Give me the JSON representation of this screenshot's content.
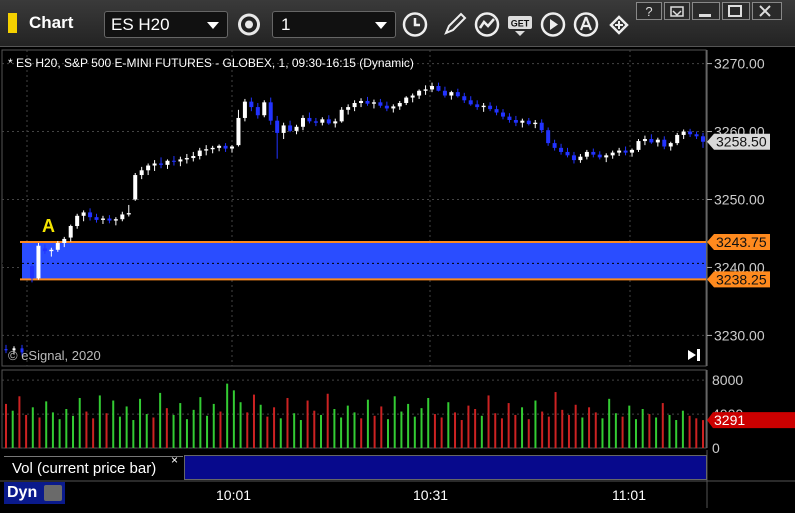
{
  "app": {
    "title": "Chart"
  },
  "toolbar": {
    "symbol": "ES H20",
    "interval": "1",
    "buttons": [
      "gear-icon",
      "clock-icon",
      "pencil-icon",
      "study-icon",
      "get-icon",
      "play-icon",
      "cursor-icon",
      "link-icon"
    ],
    "get_label": "GET"
  },
  "window": {
    "buttons": [
      "help",
      "restore",
      "maximize",
      "close"
    ],
    "help_label": "?"
  },
  "chart": {
    "header": "* ES H20, S&P 500 E-MINI FUTURES - GLOBEX, 1, 09:30-16:15 (Dynamic)",
    "copyright": "© eSignal, 2020",
    "marker_label": "A",
    "price_axis": [
      "3270.00",
      "3260.00",
      "3250.00",
      "3240.00",
      "3230.00"
    ],
    "last_price": "3258.50",
    "band_upper": "3243.75",
    "band_lower": "3238.25",
    "volume_axis": [
      "8000",
      "4000",
      "0"
    ],
    "volume_last": "3291",
    "time_axis": [
      "10:01",
      "10:31",
      "11:01"
    ],
    "colors": {
      "up": "#ffffff",
      "down": "#2233ff",
      "band": "#2a4dff",
      "band_line": "#ff8a1e",
      "vol_up": "#33cc33",
      "vol_down": "#cc2222",
      "last_price_bg": "#d8d8d8",
      "vol_last_bg": "#cc0000"
    }
  },
  "lower_panel": {
    "label": "Vol (current price bar)",
    "close": "×"
  },
  "footer": {
    "dyn": "Dyn"
  },
  "chart_data": {
    "type": "candlestick",
    "x_range": [
      "09:38",
      "11:13"
    ],
    "ylim": [
      3225.5,
      3272.0
    ],
    "candles": [
      [
        3240.2,
        3240.5,
        3237.8,
        3238.4
      ],
      [
        3238.4,
        3243.6,
        3238.2,
        3243.2
      ],
      [
        3242.8,
        3243.4,
        3242.0,
        3242.4
      ],
      [
        3242.4,
        3242.9,
        3241.6,
        3242.6
      ],
      [
        3242.6,
        3243.9,
        3242.3,
        3243.6
      ],
      [
        3243.6,
        3244.5,
        3243.0,
        3244.2
      ],
      [
        3244.4,
        3246.3,
        3243.8,
        3246.1
      ],
      [
        3246.1,
        3247.9,
        3245.7,
        3247.6
      ],
      [
        3247.6,
        3248.4,
        3246.8,
        3248.1
      ],
      [
        3248.1,
        3248.7,
        3246.9,
        3247.4
      ],
      [
        3247.4,
        3247.9,
        3246.6,
        3247.0
      ],
      [
        3247.0,
        3247.6,
        3246.4,
        3247.2
      ],
      [
        3247.2,
        3247.7,
        3246.5,
        3246.9
      ],
      [
        3246.9,
        3247.4,
        3246.2,
        3247.1
      ],
      [
        3247.1,
        3248.2,
        3246.8,
        3247.8
      ],
      [
        3247.8,
        3249.2,
        3247.5,
        3248.0
      ],
      [
        3250.0,
        3253.9,
        3249.8,
        3253.6
      ],
      [
        3253.6,
        3254.8,
        3253.0,
        3254.3
      ],
      [
        3254.3,
        3255.3,
        3253.6,
        3255.0
      ],
      [
        3255.0,
        3255.8,
        3254.2,
        3255.3
      ],
      [
        3255.3,
        3256.2,
        3254.6,
        3255.1
      ],
      [
        3255.1,
        3255.9,
        3254.5,
        3255.7
      ],
      [
        3255.7,
        3256.4,
        3255.0,
        3255.6
      ],
      [
        3255.6,
        3256.3,
        3254.9,
        3255.9
      ],
      [
        3255.9,
        3256.7,
        3255.3,
        3256.1
      ],
      [
        3256.1,
        3257.0,
        3255.6,
        3256.4
      ],
      [
        3256.4,
        3257.6,
        3255.9,
        3257.2
      ],
      [
        3257.2,
        3258.0,
        3256.5,
        3257.4
      ],
      [
        3257.4,
        3257.9,
        3256.8,
        3257.6
      ],
      [
        3257.6,
        3258.1,
        3257.1,
        3257.9
      ],
      [
        3257.9,
        3258.3,
        3257.0,
        3257.5
      ],
      [
        3257.5,
        3258.0,
        3256.9,
        3257.8
      ],
      [
        3258.0,
        3263.2,
        3257.8,
        3262.0
      ],
      [
        3262.0,
        3264.8,
        3261.5,
        3264.4
      ],
      [
        3264.4,
        3265.0,
        3263.0,
        3263.6
      ],
      [
        3263.6,
        3264.2,
        3261.9,
        3262.4
      ],
      [
        3262.4,
        3264.6,
        3262.1,
        3264.3
      ],
      [
        3264.3,
        3265.0,
        3261.0,
        3261.6
      ],
      [
        3261.6,
        3262.3,
        3256.0,
        3259.8
      ],
      [
        3259.8,
        3261.3,
        3258.9,
        3260.9
      ],
      [
        3260.9,
        3261.6,
        3259.9,
        3260.1
      ],
      [
        3260.1,
        3261.0,
        3259.6,
        3260.7
      ],
      [
        3260.7,
        3262.4,
        3260.2,
        3262.0
      ],
      [
        3262.0,
        3262.8,
        3261.2,
        3261.5
      ],
      [
        3261.5,
        3262.0,
        3260.8,
        3261.3
      ],
      [
        3261.3,
        3262.1,
        3260.9,
        3261.8
      ],
      [
        3261.8,
        3262.4,
        3261.0,
        3261.2
      ],
      [
        3261.2,
        3261.9,
        3260.6,
        3261.5
      ],
      [
        3261.5,
        3263.6,
        3261.3,
        3263.2
      ],
      [
        3263.2,
        3264.0,
        3262.5,
        3263.6
      ],
      [
        3263.6,
        3264.6,
        3263.0,
        3264.2
      ],
      [
        3264.2,
        3264.9,
        3263.6,
        3264.5
      ],
      [
        3264.5,
        3265.1,
        3263.8,
        3264.1
      ],
      [
        3264.1,
        3264.7,
        3263.4,
        3264.3
      ],
      [
        3264.3,
        3264.8,
        3263.5,
        3263.8
      ],
      [
        3263.8,
        3264.4,
        3263.0,
        3263.4
      ],
      [
        3263.4,
        3264.0,
        3262.8,
        3263.7
      ],
      [
        3263.7,
        3264.5,
        3263.2,
        3264.2
      ],
      [
        3264.2,
        3265.2,
        3263.9,
        3265.0
      ],
      [
        3265.0,
        3265.6,
        3264.3,
        3265.3
      ],
      [
        3265.3,
        3266.2,
        3264.8,
        3266.0
      ],
      [
        3266.0,
        3266.8,
        3265.4,
        3266.2
      ],
      [
        3266.2,
        3267.2,
        3265.8,
        3266.7
      ],
      [
        3266.7,
        3267.2,
        3265.9,
        3266.0
      ],
      [
        3266.0,
        3266.6,
        3265.0,
        3265.3
      ],
      [
        3265.3,
        3266.0,
        3264.7,
        3265.8
      ],
      [
        3265.8,
        3266.3,
        3265.0,
        3265.2
      ],
      [
        3265.2,
        3265.7,
        3264.2,
        3264.6
      ],
      [
        3264.6,
        3265.2,
        3263.8,
        3264.0
      ],
      [
        3264.0,
        3264.6,
        3263.2,
        3263.6
      ],
      [
        3263.6,
        3264.2,
        3262.9,
        3263.8
      ],
      [
        3263.8,
        3264.3,
        3263.0,
        3263.3
      ],
      [
        3263.3,
        3263.8,
        3262.4,
        3262.8
      ],
      [
        3262.8,
        3263.3,
        3261.8,
        3262.2
      ],
      [
        3262.2,
        3262.7,
        3261.3,
        3261.7
      ],
      [
        3261.7,
        3262.3,
        3260.8,
        3261.3
      ],
      [
        3261.3,
        3261.9,
        3260.6,
        3261.6
      ],
      [
        3261.6,
        3262.0,
        3260.9,
        3261.1
      ],
      [
        3261.1,
        3261.7,
        3260.5,
        3261.3
      ],
      [
        3261.3,
        3261.8,
        3259.8,
        3260.2
      ],
      [
        3260.2,
        3260.6,
        3257.9,
        3258.3
      ],
      [
        3258.3,
        3258.8,
        3257.2,
        3257.6
      ],
      [
        3257.6,
        3258.2,
        3256.6,
        3257.0
      ],
      [
        3257.0,
        3257.6,
        3256.2,
        3256.5
      ],
      [
        3256.5,
        3257.0,
        3255.3,
        3255.8
      ],
      [
        3255.8,
        3256.7,
        3255.4,
        3256.3
      ],
      [
        3256.3,
        3257.3,
        3255.9,
        3257.0
      ],
      [
        3257.0,
        3257.5,
        3256.2,
        3256.6
      ],
      [
        3256.6,
        3257.1,
        3255.9,
        3256.2
      ],
      [
        3256.2,
        3256.8,
        3255.5,
        3256.5
      ],
      [
        3256.5,
        3257.2,
        3256.0,
        3256.9
      ],
      [
        3256.9,
        3257.6,
        3256.4,
        3257.2
      ],
      [
        3257.2,
        3257.8,
        3256.5,
        3256.9
      ],
      [
        3256.9,
        3257.5,
        3256.3,
        3257.3
      ],
      [
        3257.3,
        3258.9,
        3257.0,
        3258.6
      ],
      [
        3258.6,
        3259.4,
        3258.0,
        3258.9
      ],
      [
        3258.9,
        3259.6,
        3258.2,
        3258.4
      ],
      [
        3258.4,
        3259.1,
        3257.8,
        3258.8
      ],
      [
        3258.8,
        3259.3,
        3257.4,
        3257.8
      ],
      [
        3257.8,
        3258.5,
        3257.2,
        3258.3
      ],
      [
        3258.3,
        3259.8,
        3258.0,
        3259.5
      ],
      [
        3259.5,
        3260.3,
        3258.9,
        3260.0
      ],
      [
        3260.0,
        3260.4,
        3259.2,
        3259.6
      ],
      [
        3259.6,
        3260.0,
        3258.9,
        3259.3
      ],
      [
        3259.3,
        3259.8,
        3257.6,
        3258.5
      ]
    ],
    "pre_candles": [
      [
        3228.0,
        3228.6,
        3227.4,
        3227.8
      ],
      [
        3227.8,
        3228.4,
        3227.2,
        3228.1
      ],
      [
        3228.1,
        3228.6,
        3227.0,
        3227.5
      ]
    ],
    "volume": [
      5200,
      4400,
      6100,
      3900,
      4800,
      3600,
      5500,
      4200,
      3400,
      4600,
      3800,
      5900,
      4300,
      3500,
      6200,
      4100,
      5600,
      3700,
      4900,
      3300,
      5800,
      4000,
      3600,
      6500,
      4700,
      3900,
      5300,
      3400,
      4500,
      6000,
      3800,
      5200,
      4300,
      7600,
      6800,
      5400,
      4200,
      6300,
      5100,
      3700,
      4800,
      3500,
      5900,
      4100,
      3300,
      5600,
      4400,
      3900,
      6400,
      4600,
      3600,
      5000,
      4200,
      3500,
      5700,
      3800,
      4900,
      3400,
      6100,
      4300,
      5200,
      3700,
      4700,
      5900,
      4000,
      3600,
      5400,
      4200,
      3300,
      5000,
      4600,
      3800,
      6200,
      4100,
      3500,
      5300,
      3900,
      4800,
      3400,
      5600,
      4300,
      3700,
      6600,
      4500,
      3900,
      5100,
      3600,
      4800,
      4200,
      3500,
      5800,
      4100,
      3700,
      5000,
      3400,
      4600,
      4000,
      3600,
      5300,
      3900,
      3300,
      4400,
      3800,
      3500,
      3291
    ],
    "band": [
      3238.25,
      3243.75
    ],
    "last_price": 3258.5
  }
}
